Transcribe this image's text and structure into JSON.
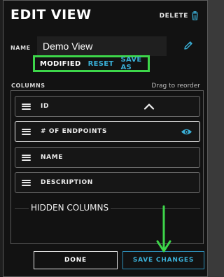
{
  "dialog": {
    "title": "EDIT VIEW",
    "delete_label": "DELETE",
    "name_label": "NAME",
    "name_value": "Demo View",
    "status": {
      "modified": "MODIFIED",
      "reset": "RESET",
      "save_as": "SAVE AS"
    },
    "columns_label": "COLUMNS",
    "reorder_hint": "Drag to reorder",
    "columns": [
      {
        "label": "ID",
        "icon": "chevron-up-icon"
      },
      {
        "label": "# OF ENDPOINTS",
        "icon": "eye-icon"
      },
      {
        "label": "NAME",
        "icon": ""
      },
      {
        "label": "DESCRIPTION",
        "icon": ""
      }
    ],
    "hidden_columns_label": "HIDDEN COLUMNS",
    "done_label": "DONE",
    "save_changes_label": "SAVE CHANGES"
  },
  "colors": {
    "accent": "#3ab0d8",
    "highlight": "#3dd64a",
    "panel_bg": "#121212"
  }
}
